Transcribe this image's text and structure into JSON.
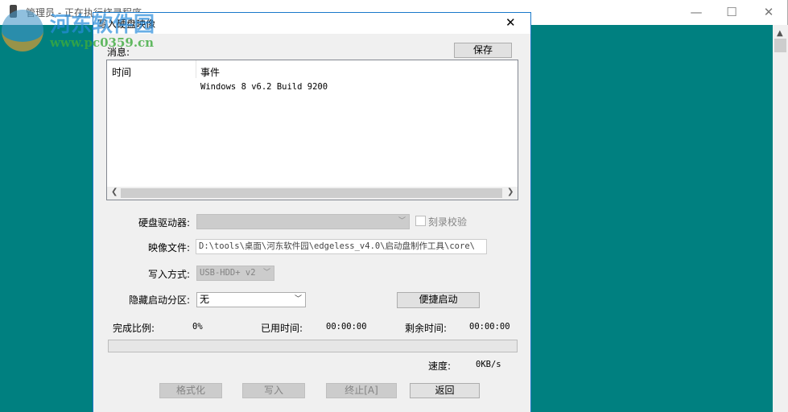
{
  "background_window": {
    "title": "管理员 - 正在执行烧录程序",
    "minimize": "—",
    "maximize": "☐",
    "close": "✕",
    "bg_color": "#008080"
  },
  "watermark": {
    "name": "河东软件园",
    "url": "www.pc0359.cn"
  },
  "dialog": {
    "title": "写入硬盘映像",
    "close": "✕",
    "message_label": "消息:",
    "save_button": "保存",
    "log": {
      "columns": [
        "时间",
        "事件"
      ],
      "rows": [
        {
          "time": "",
          "event": "Windows 8 v6.2 Build 9200"
        }
      ]
    },
    "drive_label": "硬盘驱动器:",
    "drive_value": "",
    "verify_label": "刻录校验",
    "verify_checked": false,
    "image_label": "映像文件:",
    "image_value": "D:\\tools\\桌面\\河东软件园\\edgeless_v4.0\\启动盘制作工具\\core\\",
    "mode_label": "写入方式:",
    "mode_value": "USB-HDD+ v2",
    "hidden_label": "隐藏启动分区:",
    "hidden_value": "无",
    "quick_boot_button": "便捷启动",
    "progress_label": "完成比例:",
    "progress_value": "0%",
    "progress_fraction": 0,
    "elapsed_label": "已用时间:",
    "elapsed_value": "00:00:00",
    "remaining_label": "剩余时间:",
    "remaining_value": "00:00:00",
    "speed_label": "速度:",
    "speed_value": "0KB/s",
    "buttons": {
      "format": "格式化",
      "write": "写入",
      "abort": "终止[A]",
      "back": "返回"
    }
  }
}
